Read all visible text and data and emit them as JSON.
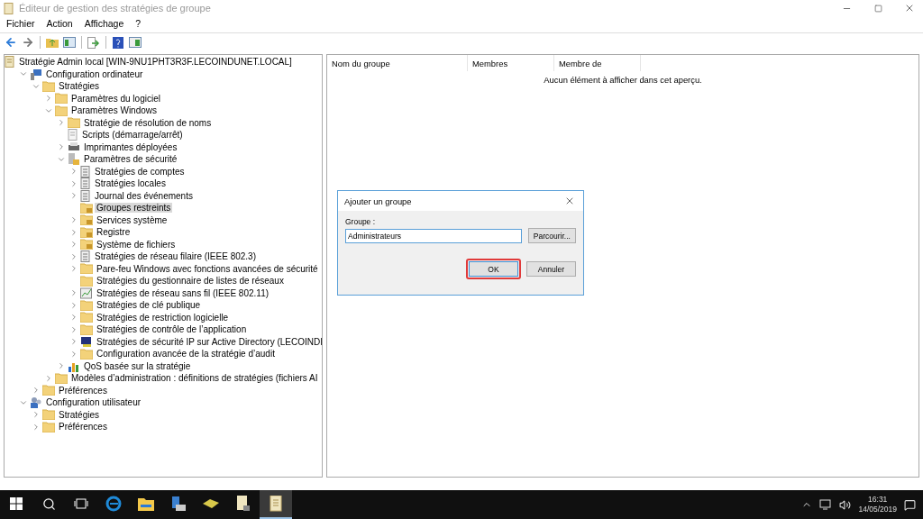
{
  "window": {
    "title": "Éditeur de gestion des stratégies de groupe"
  },
  "menu": [
    "Fichier",
    "Action",
    "Affichage",
    "?"
  ],
  "tree": [
    {
      "label": "Stratégie Admin local [WIN-9NU1PHT3R3F.LECOINDUNET.LOCAL]",
      "kind": "policy",
      "selected": false,
      "children": [
        {
          "label": "Configuration ordinateur",
          "kind": "computer",
          "expanded": true,
          "selected": false,
          "children": [
            {
              "label": "Stratégies",
              "kind": "folder",
              "expanded": true,
              "selected": false,
              "children": [
                {
                  "label": "Paramètres du logiciel",
                  "kind": "folder",
                  "expanded": false,
                  "selected": false
                },
                {
                  "label": "Paramètres Windows",
                  "kind": "folder",
                  "expanded": true,
                  "selected": false,
                  "children": [
                    {
                      "label": "Stratégie de résolution de noms",
                      "kind": "folder",
                      "expanded": false,
                      "selected": false
                    },
                    {
                      "label": "Scripts (démarrage/arrêt)",
                      "kind": "script",
                      "selected": false
                    },
                    {
                      "label": "Imprimantes déployées",
                      "kind": "printer",
                      "expanded": false,
                      "selected": false
                    },
                    {
                      "label": "Paramètres de sécurité",
                      "kind": "secure",
                      "expanded": true,
                      "selected": false,
                      "children": [
                        {
                          "label": "Stratégies de comptes",
                          "kind": "doc",
                          "expanded": false,
                          "selected": false
                        },
                        {
                          "label": "Stratégies locales",
                          "kind": "doc",
                          "expanded": false,
                          "selected": false
                        },
                        {
                          "label": "Journal des événements",
                          "kind": "doc",
                          "expanded": false,
                          "selected": false
                        },
                        {
                          "label": "Groupes restreints",
                          "kind": "lockfolder",
                          "selected": true
                        },
                        {
                          "label": "Services système",
                          "kind": "lockfolder",
                          "expanded": false,
                          "selected": false
                        },
                        {
                          "label": "Registre",
                          "kind": "lockfolder",
                          "expanded": false,
                          "selected": false
                        },
                        {
                          "label": "Système de fichiers",
                          "kind": "lockfolder",
                          "expanded": false,
                          "selected": false
                        },
                        {
                          "label": "Stratégies de réseau filaire (IEEE 802.3)",
                          "kind": "doc",
                          "expanded": false,
                          "selected": false
                        },
                        {
                          "label": "Pare-feu Windows avec fonctions avancées de sécurité",
                          "kind": "folder",
                          "expanded": false,
                          "selected": false
                        },
                        {
                          "label": "Stratégies du gestionnaire de listes de réseaux",
                          "kind": "folder",
                          "selected": false
                        },
                        {
                          "label": "Stratégies de réseau sans fil (IEEE 802.11)",
                          "kind": "chart",
                          "expanded": false,
                          "selected": false
                        },
                        {
                          "label": "Stratégies de clé publique",
                          "kind": "folder",
                          "expanded": false,
                          "selected": false
                        },
                        {
                          "label": "Stratégies de restriction logicielle",
                          "kind": "folder",
                          "expanded": false,
                          "selected": false
                        },
                        {
                          "label": "Stratégies de contrôle de l’application",
                          "kind": "folder",
                          "expanded": false,
                          "selected": false
                        },
                        {
                          "label": "Stratégies de sécurité IP sur Active Directory (LECOINDI",
                          "kind": "monitor",
                          "expanded": false,
                          "selected": false
                        },
                        {
                          "label": "Configuration avancée de la stratégie d’audit",
                          "kind": "folder",
                          "expanded": false,
                          "selected": false
                        }
                      ]
                    },
                    {
                      "label": "QoS basée sur la stratégie",
                      "kind": "bars",
                      "expanded": false,
                      "selected": false
                    }
                  ]
                },
                {
                  "label": "Modèles d’administration : définitions de stratégies (fichiers AI",
                  "kind": "folder",
                  "expanded": false,
                  "selected": false
                }
              ]
            },
            {
              "label": "Préférences",
              "kind": "folder",
              "expanded": false,
              "selected": false
            }
          ]
        },
        {
          "label": "Configuration utilisateur",
          "kind": "users",
          "expanded": true,
          "selected": false,
          "children": [
            {
              "label": "Stratégies",
              "kind": "folder",
              "expanded": false,
              "selected": false
            },
            {
              "label": "Préférences",
              "kind": "folder",
              "expanded": false,
              "selected": false
            }
          ]
        }
      ]
    }
  ],
  "table": {
    "columns": [
      "Nom du groupe",
      "Membres",
      "Membre de"
    ],
    "empty_message": "Aucun élément à afficher dans cet aperçu."
  },
  "dialog": {
    "title": "Ajouter un groupe",
    "label": "Groupe :",
    "value": "Administrateurs",
    "browse_button": "Parcourir...",
    "ok_button": "OK",
    "cancel_button": "Annuler",
    "ok_highlighted": true
  },
  "taskbar": {
    "apps": [
      {
        "kind": "ie",
        "selected": false
      },
      {
        "kind": "explorer",
        "selected": false
      },
      {
        "kind": "server",
        "selected": false
      },
      {
        "kind": "tool",
        "selected": false
      },
      {
        "kind": "gpm",
        "selected": false
      },
      {
        "kind": "gpe",
        "selected": true
      }
    ],
    "time": "16:31",
    "date": "14/05/2019"
  }
}
